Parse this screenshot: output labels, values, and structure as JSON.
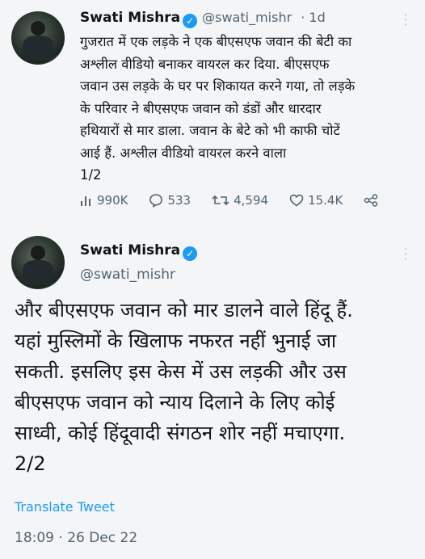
{
  "tweet1": {
    "name": "Swati Mishra",
    "handle": "@swati_mishr",
    "dot_time": "· 1d",
    "text": "गुजरात में एक लड़के ने एक बीएसएफ जवान की बेटी का\nअश्लील वीडियो बनाकर वायरल कर दिया. बीएसएफ\nजवान उस लड़के के घर पर शिकायत करने गया, तो लड़के\nके परिवार ने बीएसएफ जवान को डंडों और धारदार\nहथियारों से मार डाला. जवान के बेटे को भी काफी चोटें\nआई हैं. अश्लील वीडियो वायरल करने वाला\n1/2",
    "stats": {
      "views": "990K",
      "replies": "533",
      "retweets": "4,594",
      "likes": "15.4K"
    }
  },
  "tweet2": {
    "name": "Swati Mishra",
    "handle": "@swati_mishr",
    "text": "और बीएसएफ जवान को मार डालने वाले हिंदू हैं.\nयहां मुस्लिमों के खिलाफ नफरत नहीं भुनाई जा\nसकती. इसलिए इस केस में उस लड़की और उस\nबीएसएफ जवान को न्याय दिलाने के लिए कोई\nसाध्वी, कोई हिंदूवादी संगठन शोर नहीं मचाएगा.\n2/2",
    "translate": "Translate Tweet",
    "timestamp": "18:09 · 26 Dec 22"
  },
  "icons": {
    "verified": "verified-badge-icon",
    "views": "bar-chart-icon",
    "reply": "reply-bubble-icon",
    "retweet": "retweet-icon",
    "like": "heart-icon",
    "share": "share-icon",
    "more": "more-dots-icon"
  },
  "colors": {
    "accent": "#1d9bf0",
    "secondary_text": "#536471",
    "background": "#f3f5f7"
  }
}
